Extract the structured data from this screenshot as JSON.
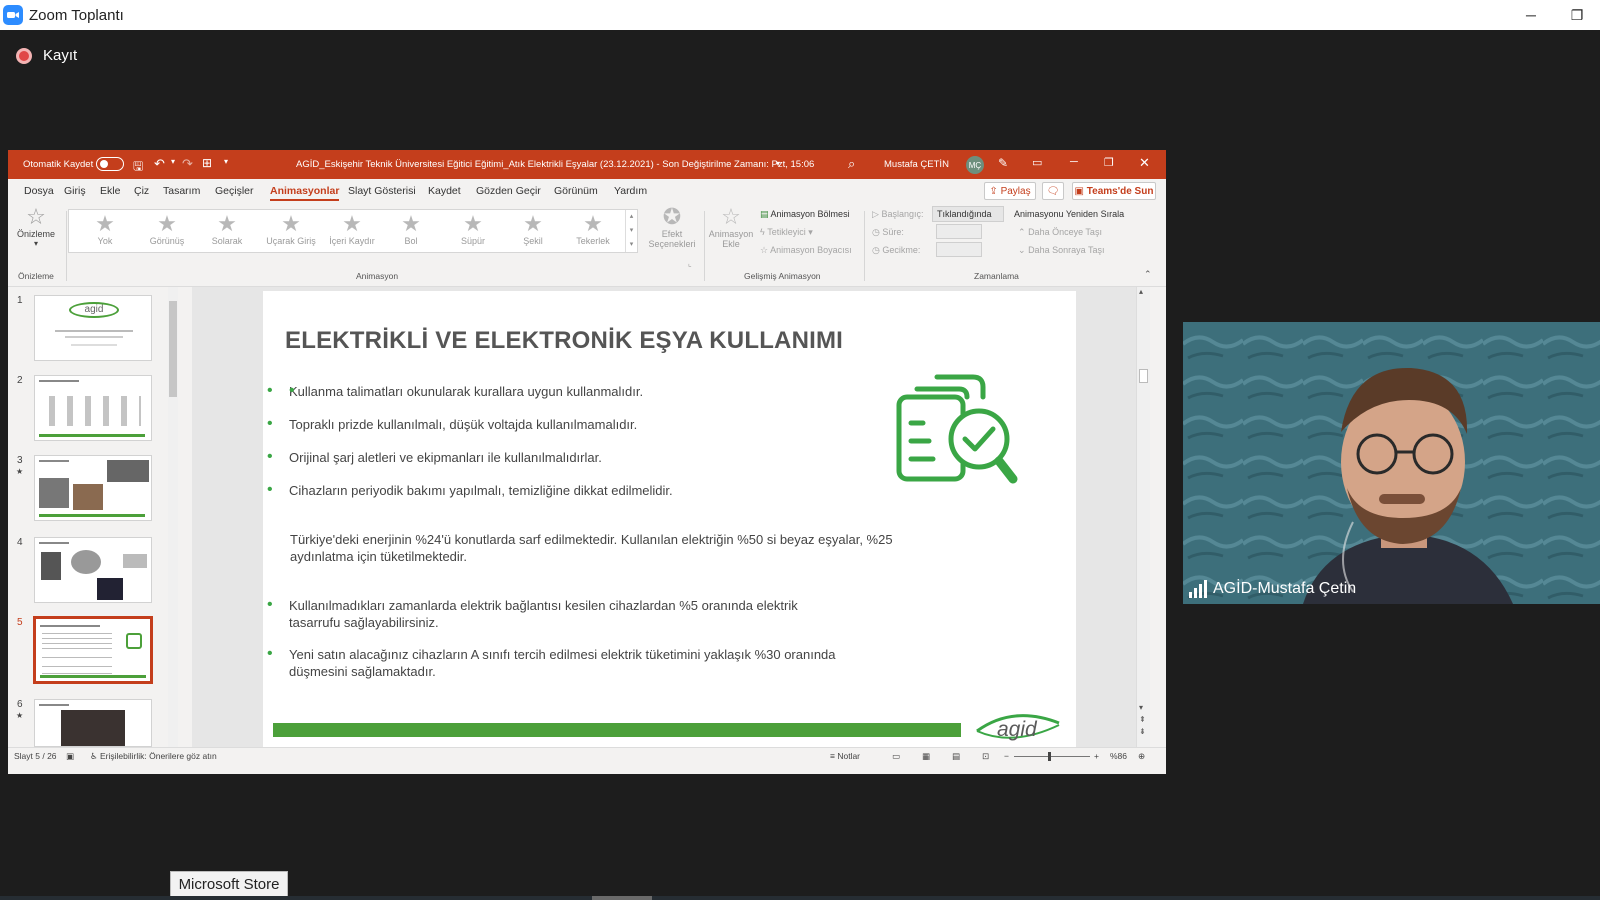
{
  "zoom": {
    "window_title": "Zoom Toplantı",
    "record_label": "Kayıt",
    "minimize": "─",
    "restore": "❐"
  },
  "ppt": {
    "autosave_label": "Otomatik Kaydet",
    "doc_title": "AGİD_Eskişehir Teknik Üniversitesi Eğitici Eğitimi_Atık Elektrikli Eşyalar (23.12.2021) - Son Değiştirilme Zamanı: Pzt, 15:06",
    "user_name": "Mustafa ÇETİN",
    "user_initials": "MÇ",
    "tabs": [
      "Dosya",
      "Giriş",
      "Ekle",
      "Çiz",
      "Tasarım",
      "Geçişler",
      "Animasyonlar",
      "Slayt Gösterisi",
      "Kaydet",
      "Gözden Geçir",
      "Görünüm",
      "Yardım"
    ],
    "active_tab": "Animasyonlar",
    "share_label": "Paylaş",
    "teams_label": "Teams'de Sun",
    "ribbon": {
      "preview_label": "Önizleme",
      "animations": [
        "Yok",
        "Görünüş",
        "Solarak",
        "Uçarak Giriş",
        "İçeri Kaydır",
        "Bol",
        "Süpür",
        "Şekil",
        "Tekerlek"
      ],
      "effect_options": "Efekt Seçenekleri",
      "add_animation": "Animasyon Ekle",
      "animation_pane": "Animasyon Bölmesi",
      "trigger": "Tetikleyici",
      "animation_painter": "Animasyon Boyacısı",
      "start_label": "Başlangıç:",
      "start_value": "Tıklandığında",
      "duration_label": "Süre:",
      "delay_label": "Gecikme:",
      "reorder_title": "Animasyonu Yeniden Sırala",
      "move_earlier": "Daha Önceye Taşı",
      "move_later": "Daha Sonraya Taşı",
      "groups": {
        "preview": "Önizleme",
        "animation": "Animasyon",
        "advanced": "Gelişmiş Animasyon",
        "timing": "Zamanlama"
      }
    },
    "thumbnails": [
      {
        "num": "1",
        "star": ""
      },
      {
        "num": "2",
        "star": ""
      },
      {
        "num": "3",
        "star": "★"
      },
      {
        "num": "4",
        "star": ""
      },
      {
        "num": "5",
        "star": ""
      },
      {
        "num": "6",
        "star": "★"
      }
    ],
    "selected_slide": 5,
    "slide": {
      "title": "ELEKTRİKLİ VE ELEKTRONİK EŞYA KULLANIMI",
      "bullets_top": [
        "Kullanma talimatları okunularak kurallara uygun kullanmalıdır.",
        "Topraklı prizde kullanılmalı, düşük voltajda kullanılmamalıdır.",
        "Orijinal şarj aletleri ve ekipmanları ile kullanılmalıdırlar.",
        "Cihazların periyodik bakımı yapılmalı, temizliğine dikkat edilmelidir."
      ],
      "paragraph": "Türkiye'deki enerjinin %24'ü konutlarda sarf edilmektedir. Kullanılan elektriğin %50 si beyaz eşyalar, %25 aydınlatma için tüketilmektedir.",
      "bullets_bottom": [
        "Kullanılmadıkları zamanlarda elektrik bağlantısı kesilen cihazlardan %5 oranında elektrik tasarrufu sağlayabilirsiniz.",
        "Yeni satın alacağınız cihazların A sınıfı tercih edilmesi elektrik tüketimini yaklaşık %30 oranında düşmesini sağlamaktadır."
      ],
      "logo_text": "agid"
    },
    "status": {
      "slide_count": "Slayt 5 / 26",
      "accessibility": "Erişilebilirlik: Önerilere göz atın",
      "notes": "Notlar",
      "zoom": "%86"
    }
  },
  "participant": {
    "name": "AGİD-Mustafa Çetin"
  },
  "taskbar": {
    "tooltip": "Microsoft Store"
  }
}
